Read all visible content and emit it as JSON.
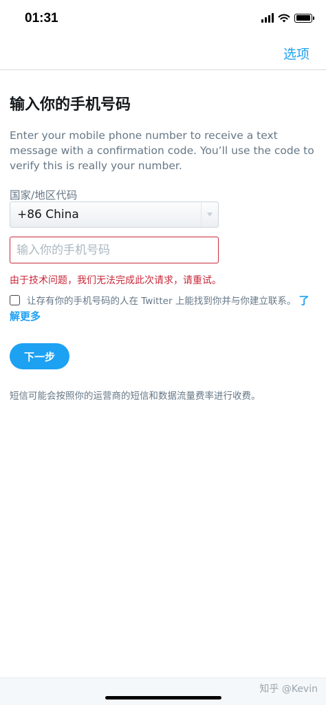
{
  "status_bar": {
    "time": "01:31"
  },
  "nav": {
    "options_label": "选项"
  },
  "title": "输入你的手机号码",
  "description": "Enter your mobile phone number to receive a text message with a confirmation code. You’ll use the code to verify this is really your number.",
  "country": {
    "label": "国家/地区代码",
    "selected": "+86 China"
  },
  "phone": {
    "placeholder": "输入你的手机号码",
    "value": ""
  },
  "error": "由于技术问题，我们无法完成此次请求，请重试。",
  "discoverability": {
    "text": "让存有你的手机号码的人在 Twitter 上能找到你并与你建立联系。",
    "learn_more": "了解更多",
    "checked": false
  },
  "next_button": "下一步",
  "sms_note": "短信可能会按照你的运营商的短信和数据流量费率进行收费。",
  "watermark": "知乎 @Kevin",
  "colors": {
    "accent": "#1da1f2",
    "error": "#c9283a",
    "secondary_text": "#657786"
  }
}
